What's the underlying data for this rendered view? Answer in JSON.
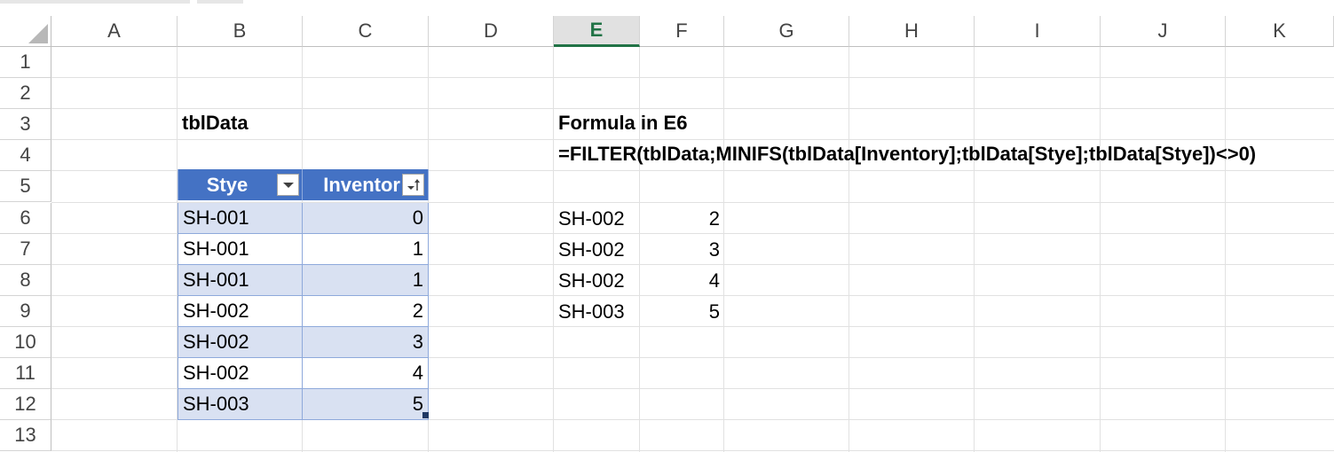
{
  "columns": [
    "A",
    "B",
    "C",
    "D",
    "E",
    "F",
    "G",
    "H",
    "I",
    "J",
    "K"
  ],
  "rows": [
    "1",
    "2",
    "3",
    "4",
    "5",
    "6",
    "7",
    "8",
    "9",
    "10",
    "11",
    "12",
    "13"
  ],
  "selected_column": "E",
  "table": {
    "name": "tblData",
    "headers": [
      "Stye",
      "Inventor"
    ],
    "rows": [
      {
        "stye": "SH-001",
        "inventory": "0"
      },
      {
        "stye": "SH-001",
        "inventory": "1"
      },
      {
        "stye": "SH-001",
        "inventory": "1"
      },
      {
        "stye": "SH-002",
        "inventory": "2"
      },
      {
        "stye": "SH-002",
        "inventory": "3"
      },
      {
        "stye": "SH-002",
        "inventory": "4"
      },
      {
        "stye": "SH-003",
        "inventory": "5"
      }
    ]
  },
  "formula_label": "Formula in E6",
  "formula_text": "=FILTER(tblData;MINIFS(tblData[Inventory];tblData[Stye];tblData[Stye])<>0)",
  "result": [
    {
      "stye": "SH-002",
      "inventory": "2"
    },
    {
      "stye": "SH-002",
      "inventory": "3"
    },
    {
      "stye": "SH-002",
      "inventory": "4"
    },
    {
      "stye": "SH-003",
      "inventory": "5"
    }
  ],
  "colors": {
    "table_header": "#4472c4",
    "table_band": "#d9e1f2",
    "selected_header_text": "#217346"
  },
  "icons": {
    "header_dropdown": "chevron-down-icon",
    "sort_dropdown": "sort-filter-icon"
  }
}
